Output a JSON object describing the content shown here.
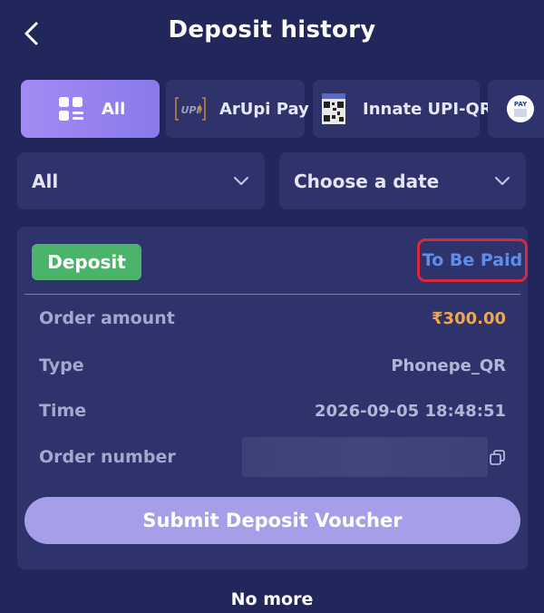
{
  "header": {
    "title": "Deposit history"
  },
  "tabs": [
    {
      "label": "All",
      "icon": "grid-list-icon"
    },
    {
      "label": "ArUpi Pay",
      "icon": "upi-logo-icon"
    },
    {
      "label": "Innate UPI-QR",
      "icon": "qr-code-icon"
    },
    {
      "label": "",
      "icon": "paytm-logo-icon"
    }
  ],
  "filters": {
    "type_value": "All",
    "date_value": "Choose a date"
  },
  "record": {
    "badge": "Deposit",
    "status": "To Be Paid",
    "rows": [
      {
        "label": "Order amount",
        "value": "₹300.00"
      },
      {
        "label": "Type",
        "value": "Phonepe_QR"
      },
      {
        "label": "Time",
        "value": "2026-09-05 18:48:51"
      },
      {
        "label": "Order number",
        "value": ""
      }
    ],
    "submit_label": "Submit Deposit Voucher"
  },
  "footer": {
    "text": "No more"
  },
  "colors": {
    "background": "#22275b",
    "panel": "#2e336c",
    "accent": "#a38bf3",
    "deposit_badge": "#4bb46b",
    "status_text": "#5f8de8",
    "highlight_border": "#d9283a",
    "amount": "#f2a54c"
  }
}
